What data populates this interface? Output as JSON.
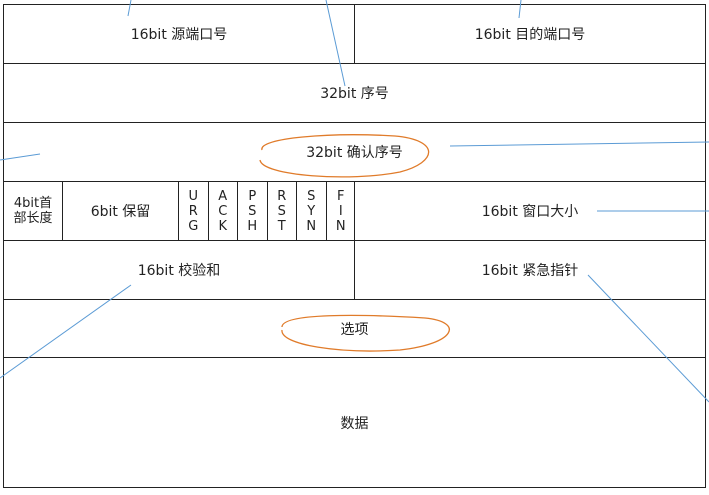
{
  "rows": {
    "ports": {
      "src": "16bit 源端口号",
      "dst": "16bit 目的端口号"
    },
    "seq": "32bit 序号",
    "ack": "32bit 确认序号",
    "ctrl": {
      "hdr_len_line1": "4bit首",
      "hdr_len_line2": "部长度",
      "reserved": "6bit 保留",
      "flags": [
        [
          "U",
          "R",
          "G"
        ],
        [
          "A",
          "C",
          "K"
        ],
        [
          "P",
          "S",
          "H"
        ],
        [
          "R",
          "S",
          "T"
        ],
        [
          "S",
          "Y",
          "N"
        ],
        [
          "F",
          "I",
          "N"
        ]
      ],
      "window": "16bit 窗口大小"
    },
    "check": {
      "checksum": "16bit 校验和",
      "urgent": "16bit 紧急指针"
    },
    "options": "选项",
    "data": "数据"
  },
  "colors": {
    "highlight": "#e07b2a",
    "pointer": "#5b9bd5",
    "border": "#222222"
  }
}
